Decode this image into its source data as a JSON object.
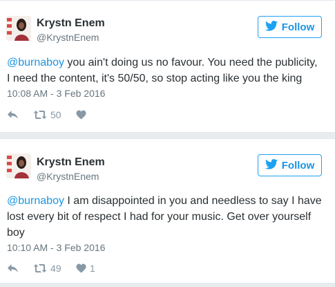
{
  "tweets": [
    {
      "author": {
        "name": "Krystn Enem",
        "handle": "@KrystnEnem"
      },
      "follow_label": "Follow",
      "text_lines": [
        {
          "mention": "@burnaboy",
          "rest": " you ain't doing us no favour. You need the publicity,"
        },
        {
          "mention": "",
          "rest": "I need the content, it's 50/50, so stop acting like you the king"
        }
      ],
      "timestamp": "10:08 AM - 3 Feb 2016",
      "retweets": "50",
      "likes": ""
    },
    {
      "author": {
        "name": "Krystn Enem",
        "handle": "@KrystnEnem"
      },
      "follow_label": "Follow",
      "text_lines": [
        {
          "mention": "@burnaboy",
          "rest": " I am disappointed in you and needless to say I have"
        },
        {
          "mention": "",
          "rest": "lost every bit of respect I had for your music. Get over yourself"
        },
        {
          "mention": "",
          "rest": "boy"
        }
      ],
      "timestamp": "10:10 AM - 3 Feb 2016",
      "retweets": "49",
      "likes": "1"
    }
  ],
  "icons": {
    "brand": "twitter-bird-icon",
    "reply": "reply-icon",
    "retweet": "retweet-icon",
    "like": "heart-icon"
  },
  "colors": {
    "link": "#1b95e0",
    "follow_border": "#1da1f2",
    "text": "#292f33",
    "muted": "#66757f",
    "icon": "#8899a6",
    "background": "#e9ecef"
  }
}
